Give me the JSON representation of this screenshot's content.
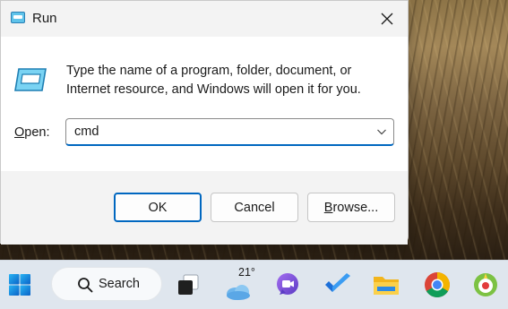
{
  "dialog": {
    "title": "Run",
    "description": "Type the name of a program, folder, document, or Internet resource, and Windows will open it for you.",
    "open_label_accel": "O",
    "open_label_rest": "pen:",
    "open_value": "cmd",
    "buttons": {
      "ok": "OK",
      "cancel": "Cancel",
      "browse_accel": "B",
      "browse_rest": "rowse..."
    }
  },
  "taskbar": {
    "search_label": "Search",
    "weather_temp": "21°",
    "icons": [
      "windows-start-icon",
      "search-icon",
      "task-view-icon",
      "weather-icon",
      "video-chat-icon",
      "todo-icon",
      "file-explorer-icon",
      "chrome-icon",
      "app-icon"
    ]
  },
  "colors": {
    "accent": "#0067c0",
    "dialog_bg": "#f3f3f3",
    "taskbar_bg": "#dfe6ee"
  }
}
